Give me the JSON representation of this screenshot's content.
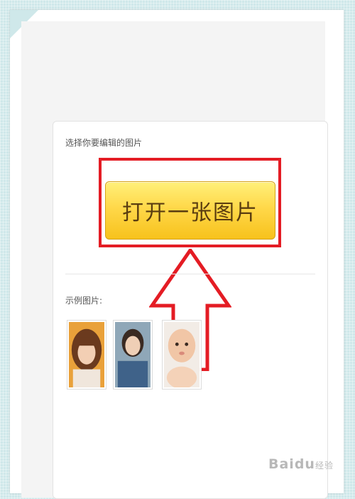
{
  "editor": {
    "select_label": "选择你要编辑的图片",
    "open_button_label": "打开一张图片",
    "sample_label": "示例图片:",
    "samples": [
      {
        "name": "sample-girl-bangs"
      },
      {
        "name": "sample-girl-selfie"
      },
      {
        "name": "sample-baby"
      }
    ]
  },
  "watermark": {
    "text": "Baidu",
    "subtext": "经验"
  },
  "colors": {
    "annotation_red": "#e41c24",
    "button_yellow": "#ffd84a",
    "button_text": "#5a3d10",
    "page_bg": "#cfe8ea"
  }
}
